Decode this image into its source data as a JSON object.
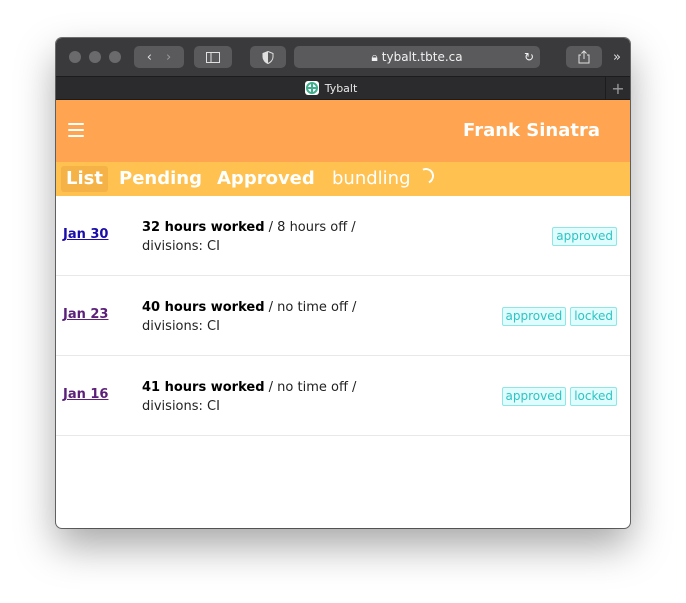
{
  "browser": {
    "url": "tybalt.tbte.ca",
    "tab_title": "Tybalt"
  },
  "header": {
    "user_name": "Frank Sinatra"
  },
  "nav": {
    "items": [
      "List",
      "Pending",
      "Approved"
    ],
    "loading_label": "bundling"
  },
  "timesheets": [
    {
      "date": "Jan 30",
      "hours_worked": "32 hours worked",
      "rest": " / 8 hours off /",
      "divisions": "divisions: CI",
      "badges": [
        "approved"
      ]
    },
    {
      "date": "Jan 23",
      "hours_worked": "40 hours worked",
      "rest": " / no time off /",
      "divisions": "divisions: CI",
      "badges": [
        "approved",
        "locked"
      ]
    },
    {
      "date": "Jan 16",
      "hours_worked": "41 hours worked",
      "rest": " / no time off /",
      "divisions": "divisions: CI",
      "badges": [
        "approved",
        "locked"
      ]
    }
  ],
  "colors": {
    "header": "#ffa552",
    "subnav": "#ffc14f",
    "badge_text": "#2ec4c4"
  }
}
